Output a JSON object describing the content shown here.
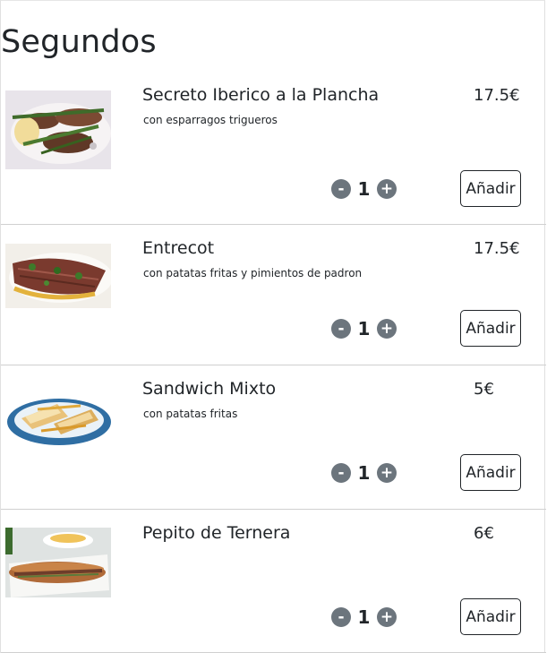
{
  "section": {
    "title": "Segundos"
  },
  "items": [
    {
      "name": "Secreto Iberico a la Plancha",
      "description": "con esparragos trigueros",
      "price": "17.5€",
      "quantity": "1",
      "minus": "-",
      "plus": "+",
      "add_label": "Añadir"
    },
    {
      "name": "Entrecot",
      "description": "con patatas fritas y pimientos de padron",
      "price": "17.5€",
      "quantity": "1",
      "minus": "-",
      "plus": "+",
      "add_label": "Añadir"
    },
    {
      "name": "Sandwich Mixto",
      "description": "con patatas fritas",
      "price": "5€",
      "quantity": "1",
      "minus": "-",
      "plus": "+",
      "add_label": "Añadir"
    },
    {
      "name": "Pepito de Ternera",
      "description": "",
      "price": "6€",
      "quantity": "1",
      "minus": "-",
      "plus": "+",
      "add_label": "Añadir"
    }
  ],
  "colors": {
    "qty_button": "#6c757d",
    "text": "#212529",
    "divider": "#d0d0d0"
  },
  "icons": {
    "decrease": "minus-icon",
    "increase": "plus-icon"
  }
}
